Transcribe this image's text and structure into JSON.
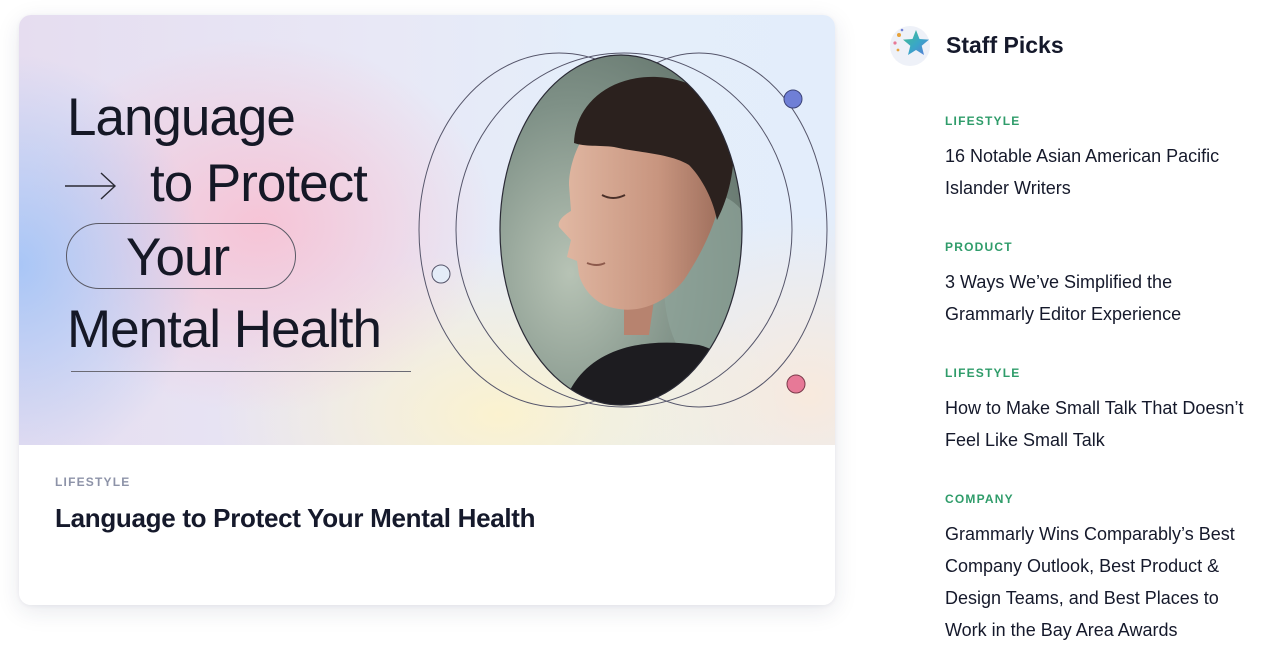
{
  "featured": {
    "hero_lines": [
      "Language",
      "to Protect",
      "Your",
      "Mental Health"
    ],
    "category": "LIFESTYLE",
    "title": "Language to Protect Your Mental Health",
    "image_subject": "woman-profile-portrait"
  },
  "staff_picks": {
    "title": "Staff Picks",
    "icon": "sparkle-star-icon",
    "items": [
      {
        "category": "LIFESTYLE",
        "title": "16 Notable Asian American Pacific Islander Writers"
      },
      {
        "category": "PRODUCT",
        "title": "3 Ways We’ve Simplified the Grammarly Editor Experience"
      },
      {
        "category": "LIFESTYLE",
        "title": "How to Make Small Talk That Doesn’t Feel Like Small Talk"
      },
      {
        "category": "COMPANY",
        "title": "Grammarly Wins Comparably’s Best Company Outlook, Best Product & Design Teams, and Best Places to Work in the Bay Area Awards"
      }
    ]
  },
  "colors": {
    "category_green": "#2f9c6a",
    "category_gray": "#8d93a8",
    "text_dark": "#15192b",
    "dot_blue": "#6f7fd6",
    "dot_pink": "#e77997"
  }
}
